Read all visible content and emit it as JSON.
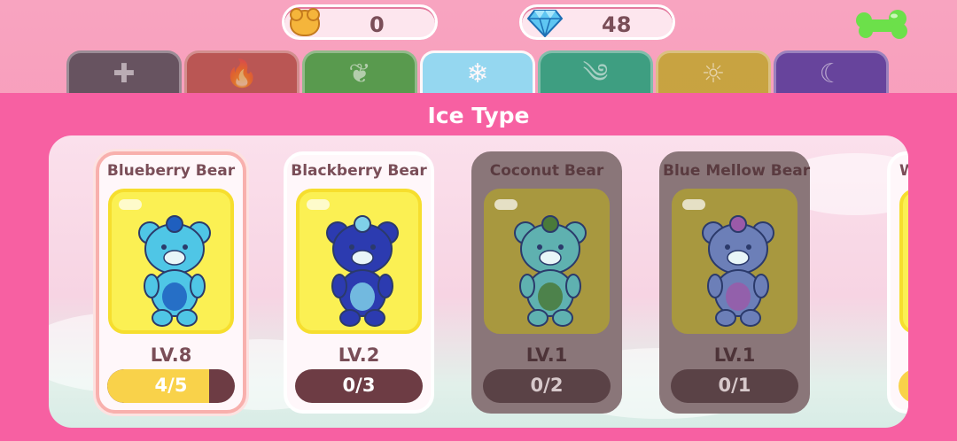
{
  "currency": {
    "coins": {
      "icon": "bear-coin-icon",
      "value": "0"
    },
    "gems": {
      "icon": "diamond-icon",
      "value": "48"
    }
  },
  "menu": {
    "icon": "green-bone-menu-icon"
  },
  "tabs": [
    {
      "name": "tab-normal",
      "icon": "plus-icon",
      "glyph": "✚",
      "color": "#5b4d59",
      "active": false
    },
    {
      "name": "tab-fire",
      "icon": "flame-icon",
      "glyph": "🔥",
      "color": "#b5504c",
      "active": false
    },
    {
      "name": "tab-grass",
      "icon": "leaf-icon",
      "glyph": "❦",
      "color": "#4c9a45",
      "active": false
    },
    {
      "name": "tab-ice",
      "icon": "snowflake-icon",
      "glyph": "❄",
      "color": "#8ddcf5",
      "active": true
    },
    {
      "name": "tab-wind",
      "icon": "swirl-icon",
      "glyph": "༄",
      "color": "#2f9e7c",
      "active": false
    },
    {
      "name": "tab-light",
      "icon": "sun-icon",
      "glyph": "☼",
      "color": "#c4a437",
      "active": false
    },
    {
      "name": "tab-dark",
      "icon": "moon-icon",
      "glyph": "☾",
      "color": "#5b3d9a",
      "active": false
    }
  ],
  "panel": {
    "title": "Ice Type"
  },
  "cards": [
    {
      "name": "Blueberry Bear",
      "level": "LV.8",
      "progress_text": "4/5",
      "progress": 0.8,
      "state": "selected",
      "bear_color": "#4fc6e6",
      "accent": "#1f5fbf"
    },
    {
      "name": "Blackberry Bear",
      "level": "LV.2",
      "progress_text": "0/3",
      "progress": 0,
      "state": "owned",
      "bear_color": "#2c3bb0",
      "accent": "#7fd0e8"
    },
    {
      "name": "Coconut Bear",
      "level": "LV.1",
      "progress_text": "0/2",
      "progress": 0,
      "state": "locked",
      "bear_color": "#5fb1b0",
      "accent": "#4a7a3a"
    },
    {
      "name": "Blue Mellow Bear",
      "level": "LV.1",
      "progress_text": "0/1",
      "progress": 0,
      "state": "locked",
      "bear_color": "#6c7fb8",
      "accent": "#9a5aa8"
    }
  ],
  "partial_card": {
    "name": "W"
  }
}
